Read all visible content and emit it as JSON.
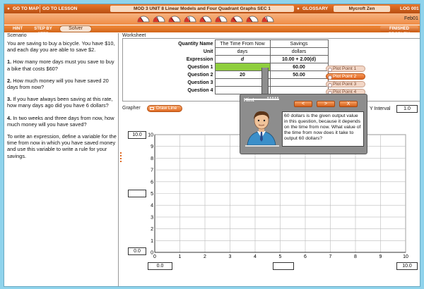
{
  "topbar": {
    "go_to_map": "GO TO MAP",
    "go_to_lesson": "GO TO LESSON",
    "module_info": "MOD 3  UNIT 8    Linear Models and Four Quadrant Graphs    SEC 1",
    "glossary": "GLOSSARY",
    "user_name": "Mycroft Zen",
    "lesson_code": "LOG 001"
  },
  "session_id": "Feb01",
  "toolbar": {
    "hint": "HINT",
    "step_by_step": "STEP BY STEP",
    "solver": "Solver",
    "finished_problem": "FINISHED PROBLEM"
  },
  "scenario": {
    "label": "Scenario",
    "intro": "You are saving to buy a bicycle. You have $10, and each day you are able to save $2.",
    "q1_num": "1.",
    "q1": "How many more days must you save to buy a bike that costs $60?",
    "q2_num": "2.",
    "q2": "How much money will you have saved 20 days from now?",
    "q3_num": "3.",
    "q3": "If you have always been saving at this rate, how many days ago did you have 6 dollars?",
    "q4_num": "4.",
    "q4": "In two weeks and three days from now, how much money will you have saved?",
    "instructions": "To write an expression, define a variable for the time from now in which you have saved money and use this variable to write a rule for your savings."
  },
  "worksheet": {
    "label": "Worksheet",
    "rows": [
      {
        "label": "Quantity Name",
        "c1": "The Time From Now",
        "c2": "Savings"
      },
      {
        "label": "Unit",
        "c1": "days",
        "c2": "dollars"
      },
      {
        "label": "Expression",
        "c1": "d",
        "c2": "10.00 + 2.00(d)"
      },
      {
        "label": "Question 1",
        "c1": "",
        "c2": "60.00"
      },
      {
        "label": "Question 2",
        "c1": "20",
        "c2": "50.00"
      },
      {
        "label": "Question 3",
        "c1": "",
        "c2": ""
      },
      {
        "label": "Question 4",
        "c1": "",
        "c2": ""
      }
    ],
    "plot_points": [
      "Plot Point 1",
      "Plot Point 2",
      "Plot Point 3",
      "Plot Point 4"
    ],
    "active_plot_point": 2
  },
  "grapher": {
    "label": "Grapher",
    "draw_line": "Draw Line",
    "y_interval_label": "Y Interval",
    "y_interval": "1.0",
    "y_top": "10.0",
    "y_bottom": "0.0",
    "x_left": "0.0",
    "x_right": "10.0",
    "y_tick_labels": [
      "10",
      "9",
      "8",
      "7",
      "6",
      "5",
      "4",
      "3",
      "2",
      "1",
      "0"
    ],
    "x_tick_labels": [
      "0",
      "1",
      "2",
      "3",
      "4",
      "5",
      "6",
      "7",
      "8",
      "9",
      "10"
    ]
  },
  "hint": {
    "title": "Hint",
    "dots": "•••••",
    "prev": "<",
    "next": ">",
    "close": "X",
    "text": "60 dollars is the given output value in this question, because it depends on the time from now. What value of the time from now does it take to output 60 dollars?"
  },
  "colors": {
    "orange": "#e06a22",
    "highlight_green": "#8fce3e",
    "background": "#8fd3ec"
  }
}
